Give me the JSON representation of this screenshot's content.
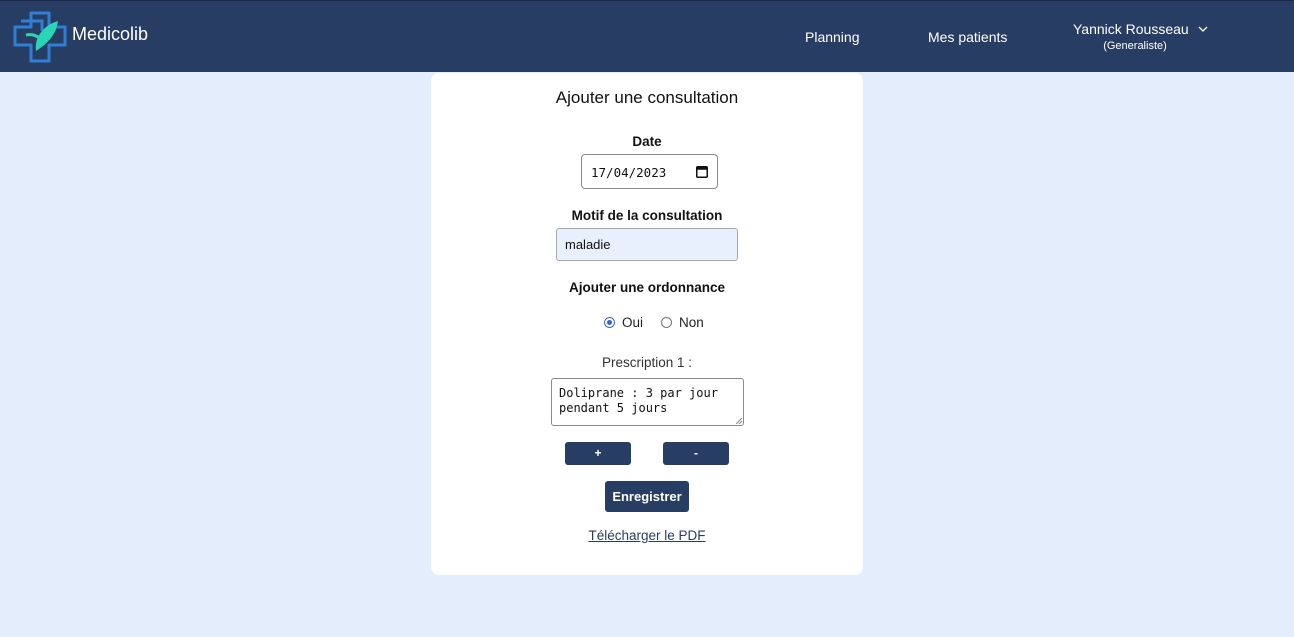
{
  "app": {
    "brand": "Medicolib",
    "colors": {
      "navbar": "#283d63",
      "background": "#e3edfc",
      "logo_blue": "#2f7fd6",
      "logo_green": "#2bd6b8"
    }
  },
  "nav": {
    "links": [
      "Planning",
      "Mes patients"
    ],
    "user": {
      "name": "Yannick Rousseau",
      "role": "(Generaliste)",
      "icon": "chevron-down-icon"
    }
  },
  "form": {
    "title": "Ajouter une consultation",
    "date": {
      "label": "Date",
      "value": "17/04/2023",
      "icon": "calendar-icon"
    },
    "motif": {
      "label": "Motif de la consultation",
      "value": "maladie"
    },
    "ordonnance": {
      "label": "Ajouter une ordonnance",
      "options": [
        "Oui",
        "Non"
      ],
      "selected": "Oui"
    },
    "prescriptions": [
      {
        "label": "Prescription 1 :",
        "value": "Doliprane : 3 par jour\npendant 5 jours"
      }
    ],
    "add_label": "+",
    "remove_label": "-",
    "save_label": "Enregistrer",
    "pdf_link": "Télécharger le PDF"
  }
}
